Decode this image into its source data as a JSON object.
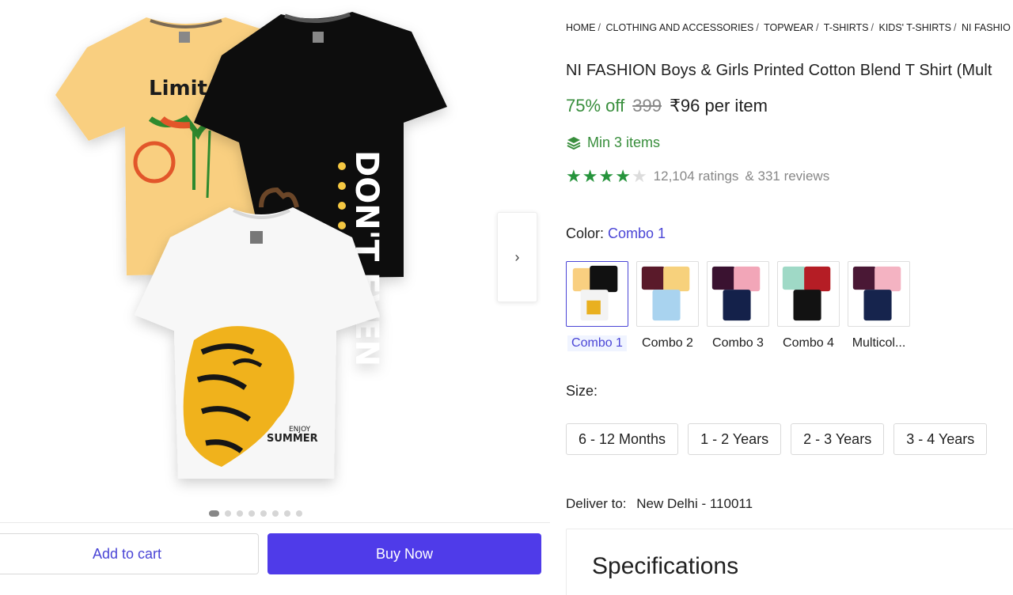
{
  "breadcrumb": [
    "Home",
    "Clothing and Accessories",
    "Topwear",
    "T-Shirts",
    "Kids' T-Shirts",
    "NI FASHIO"
  ],
  "product": {
    "title": "NI FASHION Boys & Girls Printed Cotton Blend T Shirt (Mult",
    "discount": "75% off",
    "mrp": "399",
    "price": "₹96 per item",
    "min_items": "Min 3 items",
    "rating": 4,
    "rating_max": 5,
    "ratings_count": "12,104 ratings",
    "reviews_count": "& 331 reviews"
  },
  "gallery": {
    "image_count": 8,
    "active_index": 0,
    "image_texts": {
      "tee1_print": "Limited Edition",
      "tee2_print": "DON'T EVEN",
      "tee3_small": "ENJOY",
      "tee3_big": "SUMMER"
    }
  },
  "color": {
    "label": "Color:",
    "selected": "Combo 1",
    "options": [
      "Combo 1",
      "Combo 2",
      "Combo 3",
      "Combo 4",
      "Multicol..."
    ]
  },
  "size": {
    "label": "Size:",
    "options": [
      "6 - 12 Months",
      "1 - 2 Years",
      "2 - 3 Years",
      "3 - 4 Years"
    ]
  },
  "delivery": {
    "label": "Deliver to:",
    "location": "New Delhi - 110011"
  },
  "actions": {
    "add_to_cart": "Add to cart",
    "buy_now": "Buy Now"
  },
  "specs": {
    "title": "Specifications"
  },
  "colors": {
    "accent": "#4f3be9",
    "link": "#4a45d6",
    "green": "#388e3c",
    "star": "#26943c"
  },
  "icons": {
    "next": "chevron-right-icon",
    "min_items": "stack-layers-icon",
    "star": "star-icon"
  }
}
